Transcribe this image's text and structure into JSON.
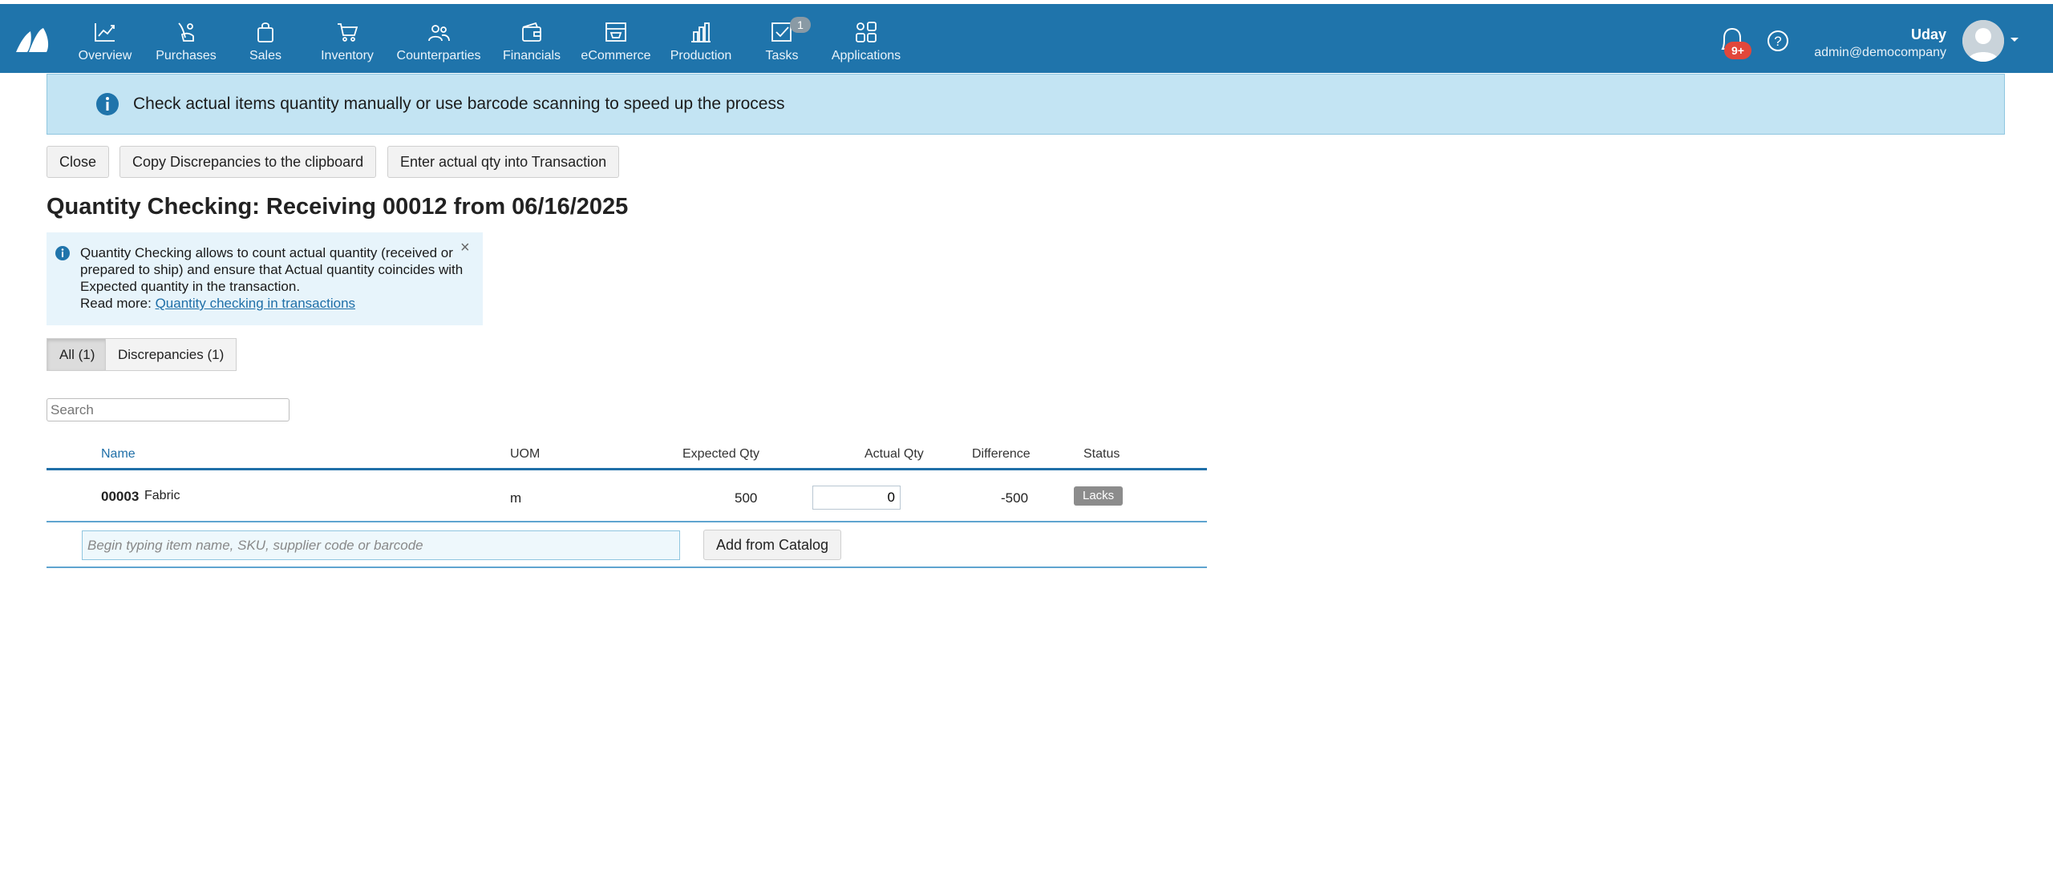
{
  "nav": {
    "items": [
      {
        "label": "Overview",
        "icon": "chart-line-icon"
      },
      {
        "label": "Purchases",
        "icon": "purchases-hand-icon"
      },
      {
        "label": "Sales",
        "icon": "shopping-bag-icon"
      },
      {
        "label": "Inventory",
        "icon": "cart-icon"
      },
      {
        "label": "Counterparties",
        "icon": "people-icon"
      },
      {
        "label": "Financials",
        "icon": "wallet-icon"
      },
      {
        "label": "eCommerce",
        "icon": "storefront-icon"
      },
      {
        "label": "Production",
        "icon": "bar-building-icon"
      },
      {
        "label": "Tasks",
        "icon": "checkbox-icon",
        "badge": "1"
      },
      {
        "label": "Applications",
        "icon": "apps-grid-icon"
      }
    ],
    "notifications_badge": "9+",
    "user_name": "Uday",
    "user_email": "admin@democompany",
    "colors": {
      "bar": "#1f74ab",
      "badge": "#e2473b"
    }
  },
  "banner": {
    "text": "Check actual items quantity manually or use barcode scanning to speed up the process"
  },
  "toolbar": {
    "close_label": "Close",
    "copy_label": "Copy Discrepancies to the clipboard",
    "enter_label": "Enter actual qty into Transaction"
  },
  "page_title": "Quantity Checking: Receiving 00012 from 06/16/2025",
  "info": {
    "text": "Quantity Checking allows to count actual quantity (received or prepared to ship) and ensure that Actual quantity coincides with Expected quantity in the transaction.",
    "read_more": "Read more:",
    "link_text": "Quantity checking in transactions",
    "close": "×"
  },
  "tabs": [
    {
      "label": "All (1)",
      "active": true
    },
    {
      "label": "Discrepancies (1)",
      "active": false
    }
  ],
  "search": {
    "placeholder": "Search"
  },
  "table": {
    "headers": {
      "name": "Name",
      "uom": "UOM",
      "expected": "Expected Qty",
      "actual": "Actual Qty",
      "difference": "Difference",
      "status": "Status"
    },
    "rows": [
      {
        "code": "00003",
        "name": "Fabric",
        "uom": "m",
        "expected": "500",
        "actual": "0",
        "difference": "-500",
        "status": "Lacks"
      }
    ]
  },
  "add_item": {
    "placeholder": "Begin typing item name, SKU, supplier code or barcode",
    "button_label": "Add from Catalog"
  }
}
